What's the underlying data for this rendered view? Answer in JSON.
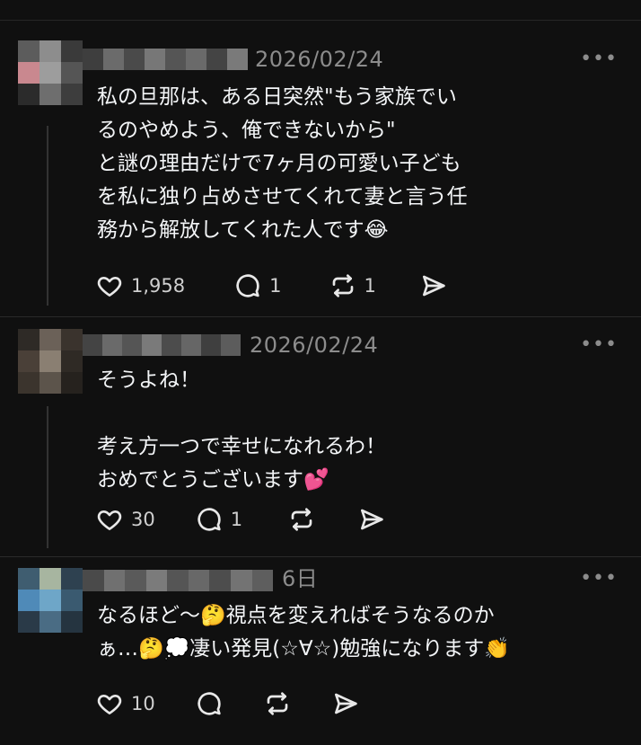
{
  "posts": [
    {
      "date": "2026/02/24",
      "more": "•••",
      "text": "私の旦那は、ある日突然\"もう家族でい\nるのやめよう、俺できないから\"\nと謎の理由だけで7ヶ月の可愛い子ども\nを私に独り占めさせてくれて妻と言う任\n務から解放してくれた人です😂",
      "likes": "1,958",
      "replies": "1",
      "reposts": "1",
      "share": ""
    },
    {
      "date": "2026/02/24",
      "more": "•••",
      "text": "そうよね！\n\n考え方一つで幸せになれるわ！\nおめでとうございます💕",
      "likes": "30",
      "replies": "1",
      "reposts": "",
      "share": ""
    },
    {
      "date": "6日",
      "more": "•••",
      "text": "なるほど〜🤔視点を変えればそうなるのか\nぁ…🤔💭凄い発見(☆∀☆)勉強になります👏",
      "likes": "10",
      "replies": "",
      "reposts": "",
      "share": ""
    }
  ],
  "icons": {
    "like": "heart-icon",
    "reply": "comment-icon",
    "repost": "repost-icon",
    "share": "send-icon",
    "more": "more-icon"
  },
  "colors": {
    "background": "#101010",
    "text": "#f3f5f7",
    "muted": "#8c8c8c"
  }
}
